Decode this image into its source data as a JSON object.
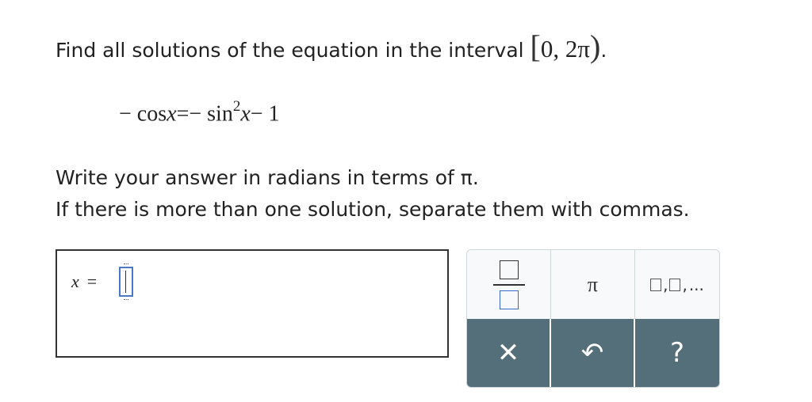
{
  "question": {
    "prompt_text": "Find all solutions of the equation in the interval",
    "interval": {
      "open": "[",
      "content": "0, 2π",
      "close": ")",
      "trailing": "."
    },
    "equation": {
      "lhs": "− cos",
      "lhs_var": "x",
      "equals": "=",
      "rhs": "− sin",
      "exponent": "2",
      "rhs_var": "x",
      "rhs_tail": "− 1"
    },
    "instruction1": "Write your answer in radians in terms of π.",
    "instruction2": "If there is more than one solution, separate them with commas."
  },
  "answer": {
    "variable": "x",
    "equals": "="
  },
  "keypad": {
    "pi_label": "π",
    "list_separator": ",",
    "list_ellipsis": "...",
    "clear_glyph": "✕",
    "undo_glyph": "↶",
    "help_glyph": "?"
  },
  "colors": {
    "keypad_dark": "#546e7a",
    "slot_blue": "#4a78c8"
  }
}
